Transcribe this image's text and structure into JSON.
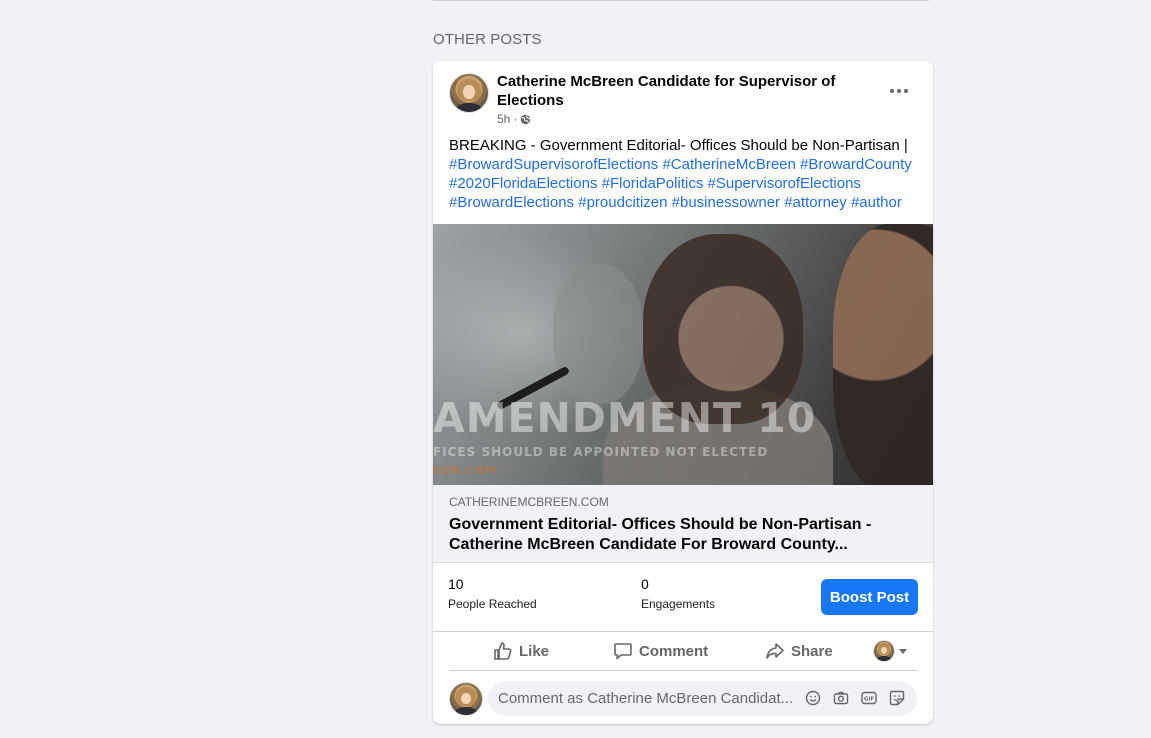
{
  "section": {
    "heading": "OTHER POSTS"
  },
  "post": {
    "author": "Catherine McBreen Candidate for Supervisor of Elections",
    "time": "5h",
    "separator": "·",
    "privacy_icon": "globe-icon",
    "more_icon": "more-options-icon",
    "text_prefix": "BREAKING - Government Editorial- Offices Should be Non-Partisan |",
    "hashtags": [
      "#BrowardSupervisorofElections",
      "#CatherineMcBreen",
      "#BrowardCounty",
      "#2020FloridaElections",
      "#FloridaPolitics",
      "#SupervisorofElections",
      "#BrowardElections",
      "#proudcitizen",
      "#businessowner",
      "#attorney",
      "#author"
    ],
    "image_overlay": {
      "headline": "AMENDMENT 10",
      "subline": "FICES SHOULD BE APPOINTED NOT ELECTED",
      "domain_fragment": "EEN.COM"
    },
    "link": {
      "domain": "CATHERINEMCBREEN.COM",
      "title": "Government Editorial- Offices Should be Non-Partisan - Catherine McBreen Candidate For Broward County..."
    },
    "stats": {
      "reached_value": "10",
      "reached_label": "People Reached",
      "engagements_value": "0",
      "engagements_label": "Engagements"
    },
    "boost_label": "Boost Post",
    "actions": {
      "like": "Like",
      "comment": "Comment",
      "share": "Share"
    },
    "comment_box": {
      "placeholder": "Comment as Catherine McBreen Candidat...",
      "icons": [
        "emoji-icon",
        "camera-icon",
        "gif-icon",
        "sticker-icon"
      ]
    }
  },
  "colors": {
    "accent": "#1877f2",
    "hashtag": "#216fdb",
    "background": "#f0f2f5",
    "secondary_text": "#65676b"
  }
}
